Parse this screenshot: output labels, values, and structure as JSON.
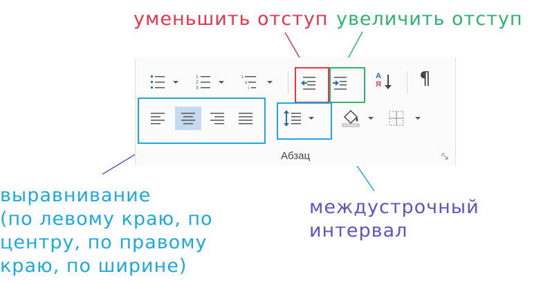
{
  "annotations": {
    "decrease_indent": "уменьшить отступ",
    "increase_indent": "увеличить отступ",
    "alignment": [
      "выравнивание",
      "(по левому краю, по",
      "центру, по правому",
      "краю, по ширине)"
    ],
    "line_spacing": [
      "междустрочный",
      "интервал"
    ]
  },
  "ribbon": {
    "group_label": "Абзац",
    "sort_glyph_top": "А",
    "sort_glyph_bottom": "Я",
    "pilcrow": "¶"
  },
  "colors": {
    "decrease_indent_box": "#e8344a",
    "increase_indent_box": "#2fb36c",
    "alignment_box": "#1ea8e0",
    "line_spacing_box": "#1ea8e0",
    "alignment_label": "#1ea8e0",
    "line_spacing_label": "#5b54c6",
    "selected_button": "#c5d9ef"
  },
  "icons": [
    "bullets-icon",
    "numbering-icon",
    "multilevel-list-icon",
    "decrease-indent-icon",
    "increase-indent-icon",
    "sort-icon",
    "show-formatting-icon",
    "align-left-icon",
    "align-center-icon",
    "align-right-icon",
    "justify-icon",
    "line-spacing-icon",
    "shading-icon",
    "borders-icon"
  ]
}
